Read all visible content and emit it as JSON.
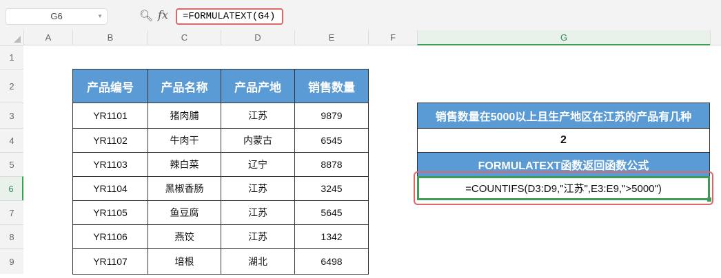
{
  "formula_bar": {
    "name_box": "G6",
    "formula": "=FORMULATEXT(G4)",
    "zoom_icon": "magnifier-icon",
    "fx_label": "fx"
  },
  "columns": [
    "A",
    "B",
    "C",
    "D",
    "E",
    "F",
    "G"
  ],
  "rows": [
    "1",
    "2",
    "3",
    "4",
    "5",
    "6",
    "7",
    "8",
    "9"
  ],
  "table": {
    "headers": [
      "产品编号",
      "产品名称",
      "产品产地",
      "销售数量"
    ],
    "rows": [
      [
        "YR1101",
        "猪肉脯",
        "江苏",
        "9879"
      ],
      [
        "YR1102",
        "牛肉干",
        "内蒙古",
        "6545"
      ],
      [
        "YR1103",
        "辣白菜",
        "辽宁",
        "8878"
      ],
      [
        "YR1104",
        "黑椒香肠",
        "江苏",
        "3245"
      ],
      [
        "YR1105",
        "鱼豆腐",
        "江苏",
        "5645"
      ],
      [
        "YR1106",
        "燕饺",
        "江苏",
        "1342"
      ],
      [
        "YR1107",
        "培根",
        "湖北",
        "6498"
      ]
    ]
  },
  "side": {
    "question": "销售数量在5000以上且生产地区在江苏的产品有几种",
    "answer": "2",
    "label": "FORMULATEXT函数返回函数公式",
    "formula_text": "=COUNTIFS(D3:D9,\"江苏\",E3:E9,\">5000\")"
  },
  "colors": {
    "header_blue": "#5b9bd5",
    "highlight_red": "#e06666",
    "selection_green": "#3f9b55"
  }
}
